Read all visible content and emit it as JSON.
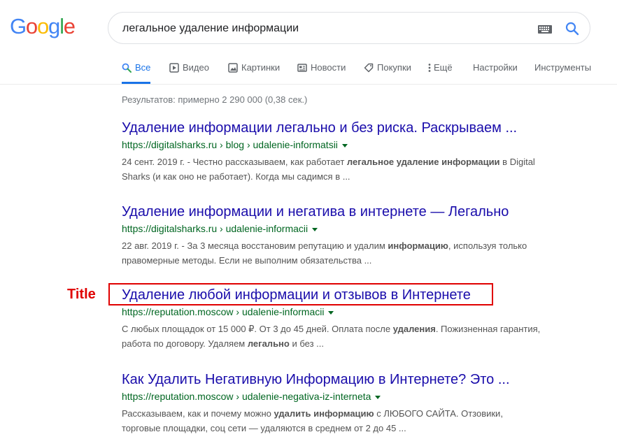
{
  "logo": {
    "letters": [
      {
        "ch": "G",
        "color": "#4285F4"
      },
      {
        "ch": "o",
        "color": "#EA4335"
      },
      {
        "ch": "o",
        "color": "#FBBC05"
      },
      {
        "ch": "g",
        "color": "#4285F4"
      },
      {
        "ch": "l",
        "color": "#34A853"
      },
      {
        "ch": "e",
        "color": "#EA4335"
      }
    ]
  },
  "search": {
    "query": "легальное удаление информации",
    "keyboard_icon": "keyboard-icon",
    "search_icon": "search-icon"
  },
  "tabs": [
    {
      "label": "Все",
      "icon": "search-icon",
      "active": true
    },
    {
      "label": "Видео",
      "icon": "play-icon"
    },
    {
      "label": "Картинки",
      "icon": "image-icon"
    },
    {
      "label": "Новости",
      "icon": "news-icon"
    },
    {
      "label": "Покупки",
      "icon": "tag-icon"
    },
    {
      "label": "Ещё",
      "icon": "more-dots-icon"
    },
    {
      "label": "Настройки"
    },
    {
      "label": "Инструменты"
    }
  ],
  "stats": "Результатов: примерно 2 290 000 (0,38 сек.)",
  "results": [
    {
      "title": "Удаление информации легально и без риска. Раскрываем ...",
      "url": "https://digitalsharks.ru › blog › udalenie-informatsii",
      "snippet": [
        {
          "t": "24 сент. 2019 г. - Честно рассказываем, как работает "
        },
        {
          "t": "легальное удаление информации",
          "b": true
        },
        {
          "t": " в Digital Sharks (и как оно не работает). Когда мы садимся в ..."
        }
      ]
    },
    {
      "title": "Удаление информации и негатива в интернете — Легально",
      "url": "https://digitalsharks.ru › udalenie-informacii",
      "snippet": [
        {
          "t": "22 авг. 2019 г. - За 3 месяца восстановим репутацию и удалим "
        },
        {
          "t": "информацию",
          "b": true
        },
        {
          "t": ", используя только правомерные методы. Если не выполним обязательства ..."
        }
      ]
    },
    {
      "title": "Удаление любой информации и отзывов в Интернете",
      "url": "https://reputation.moscow › udalenie-informacii",
      "snippet": [
        {
          "t": "С любых площадок от 15 000 ₽. От 3 до 45 дней. Оплата после "
        },
        {
          "t": "удаления",
          "b": true
        },
        {
          "t": ". Пожизненная гарантия, работа по договору. Удаляем "
        },
        {
          "t": "легально",
          "b": true
        },
        {
          "t": " и без ..."
        }
      ]
    },
    {
      "title": "Как Удалить Негативную Информацию в Интернете? Это ...",
      "url": "https://reputation.moscow › udalenie-negativa-iz-interneta",
      "snippet": [
        {
          "t": "Рассказываем, как и почему можно "
        },
        {
          "t": "удалить информацию",
          "b": true
        },
        {
          "t": " с ЛЮБОГО САЙТА. Отзовики, торговые площадки, соц сети — удаляются в среднем от 2 до 45 ..."
        }
      ]
    }
  ],
  "annotation": {
    "label": "Title",
    "color": "#e00000"
  }
}
